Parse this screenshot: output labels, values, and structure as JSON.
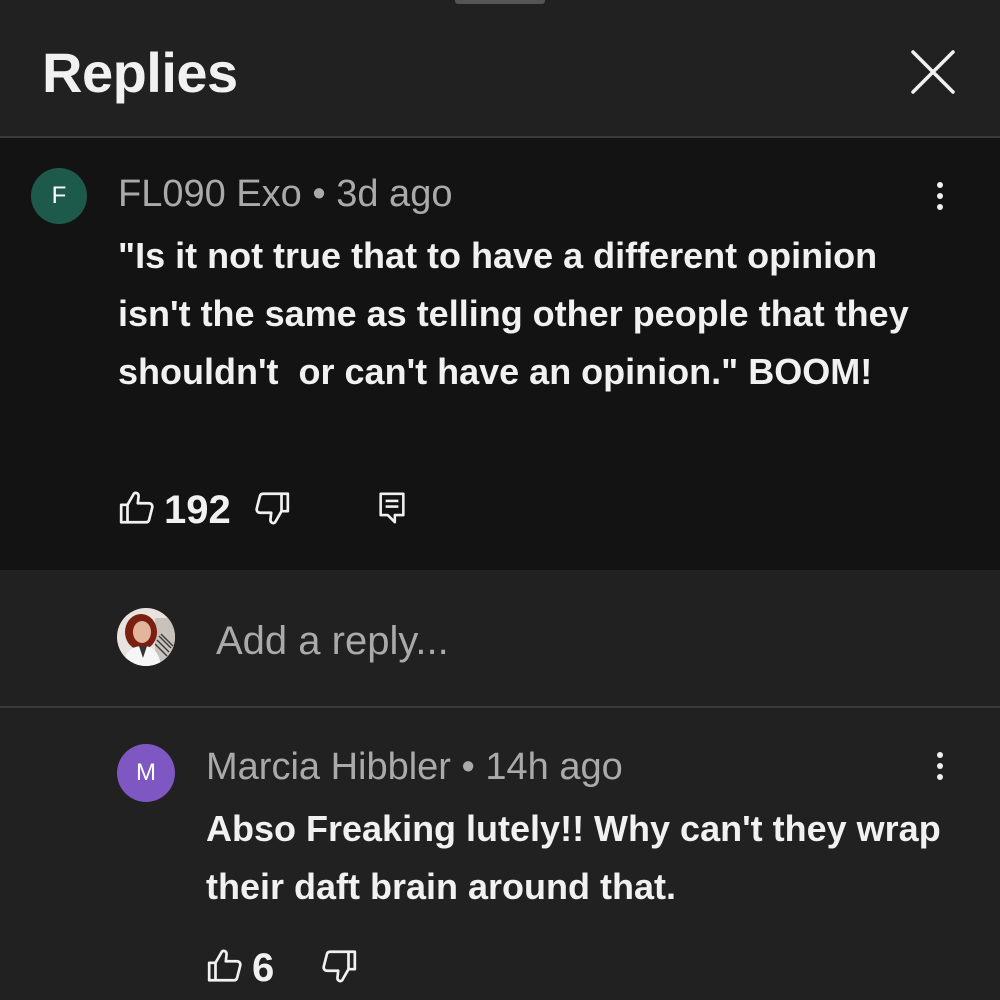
{
  "header": {
    "title": "Replies",
    "close_icon": "close-icon"
  },
  "parent_comment": {
    "avatar_letter": "F",
    "avatar_color": "#1e5a4c",
    "author": "FL090 Exo",
    "separator": "•",
    "time": "3d ago",
    "text": "\"Is it not true that to have a different opinion isn't the same as telling other people that they shouldn't  or can't have an opinion.\" BOOM!",
    "likes": "192",
    "icons": [
      "like-icon",
      "dislike-icon",
      "reply-icon",
      "more-options-icon"
    ]
  },
  "reply_box": {
    "placeholder": "Add a reply..."
  },
  "replies": [
    {
      "avatar_letter": "M",
      "avatar_color": "#7e57c2",
      "author": "Marcia Hibbler",
      "separator": "•",
      "time": "14h ago",
      "text": "Abso Freaking lutely!! Why can't they wrap their daft brain around that.",
      "likes": "6"
    }
  ],
  "colors": {
    "background": "#212121",
    "comment_background": "#131313",
    "text_primary": "#f1f1f1",
    "text_secondary": "#aaaaaa"
  }
}
